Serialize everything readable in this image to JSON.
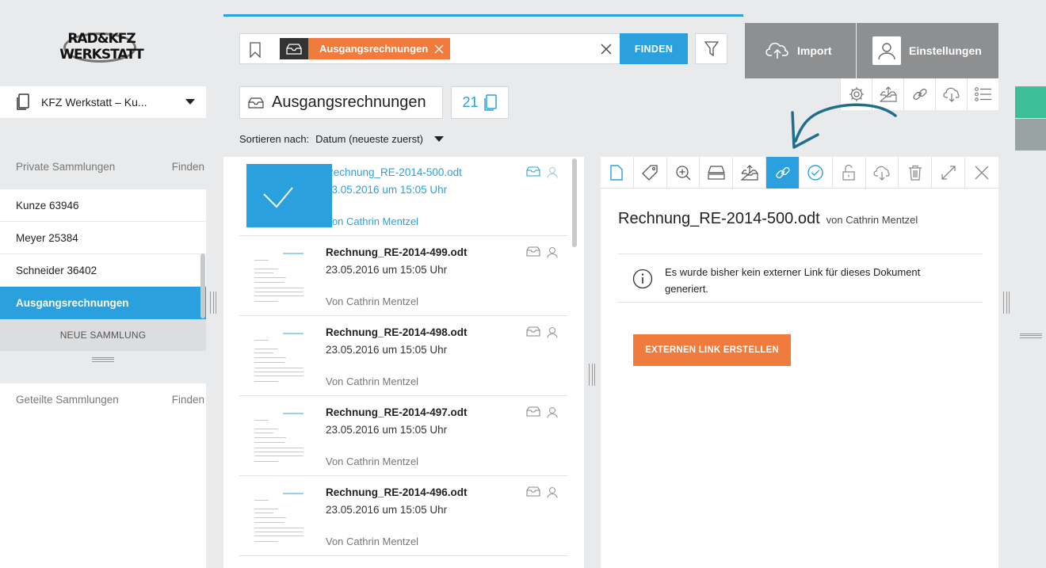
{
  "sidebar": {
    "logo": {
      "line1": "RAD&KFZ",
      "line2": "WERKSTATT"
    },
    "workspace": "KFZ Werkstatt – Ku...",
    "private_header": "Private Sammlungen",
    "find_label": "Finden",
    "collections": [
      {
        "label": "Kunze 63946",
        "active": false
      },
      {
        "label": "Meyer 25384",
        "active": false
      },
      {
        "label": "Schneider 36402",
        "active": false
      },
      {
        "label": "Ausgangsrechnungen",
        "active": true
      }
    ],
    "new_collection": "NEUE SAMMLUNG",
    "shared_header": "Geteilte Sammlungen"
  },
  "search": {
    "tag": "Ausgangsrechnungen",
    "find_button": "FINDEN"
  },
  "top_actions": {
    "import": "Import",
    "settings": "Einstellungen"
  },
  "collection": {
    "title": "Ausgangsrechnungen",
    "count": "21",
    "sort_label": "Sortieren nach:",
    "sort_value": "Datum (neueste zuerst)"
  },
  "documents": [
    {
      "name": "Rechnung_RE-2014-500.odt",
      "date": "23.05.2016 um 15:05 Uhr",
      "author": "Von Cathrin Mentzel",
      "selected": true
    },
    {
      "name": "Rechnung_RE-2014-499.odt",
      "date": "23.05.2016 um 15:05 Uhr",
      "author": "Von Cathrin Mentzel",
      "selected": false
    },
    {
      "name": "Rechnung_RE-2014-498.odt",
      "date": "23.05.2016 um 15:05 Uhr",
      "author": "Von Cathrin Mentzel",
      "selected": false
    },
    {
      "name": "Rechnung_RE-2014-497.odt",
      "date": "23.05.2016 um 15:05 Uhr",
      "author": "Von Cathrin Mentzel",
      "selected": false
    },
    {
      "name": "Rechnung_RE-2014-496.odt",
      "date": "23.05.2016 um 15:05 Uhr",
      "author": "Von Cathrin Mentzel",
      "selected": false
    }
  ],
  "detail": {
    "name": "Rechnung_RE-2014-500.odt",
    "by": "von Cathrin Mentzel",
    "info": "Es wurde bisher kein externer Link für dieses Dokument generiert.",
    "button": "EXTERNEN LINK ERSTELLEN"
  },
  "colors": {
    "accent_blue": "#2aa1de",
    "accent_orange": "#f07b3c",
    "accent_green": "#3cbf99",
    "button_gray": "#8e8f90"
  }
}
